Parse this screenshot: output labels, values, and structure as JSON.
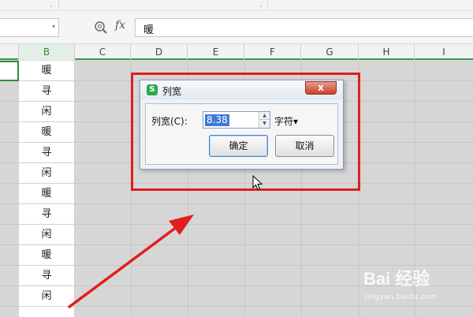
{
  "formula_bar": {
    "name_box_value": "",
    "fx_label": "fx",
    "formula_value": "暖"
  },
  "columns": [
    "B",
    "C",
    "D",
    "E",
    "F",
    "G",
    "H",
    "I"
  ],
  "selected_column": "B",
  "column_b_cells": [
    "暖",
    "寻",
    "闲",
    "暖",
    "寻",
    "闲",
    "暖",
    "寻",
    "闲",
    "暖",
    "寻",
    "闲"
  ],
  "dialog": {
    "title": "列宽",
    "width_label": "列宽(C):",
    "width_value": "8.38",
    "unit_label": "字符▾",
    "ok_label": "确定",
    "cancel_label": "取消",
    "close_glyph": "x"
  },
  "annotation_color": "#e01e1e",
  "watermark": {
    "brand": "Bai 经验",
    "url": "jingyan.baidu.com"
  }
}
